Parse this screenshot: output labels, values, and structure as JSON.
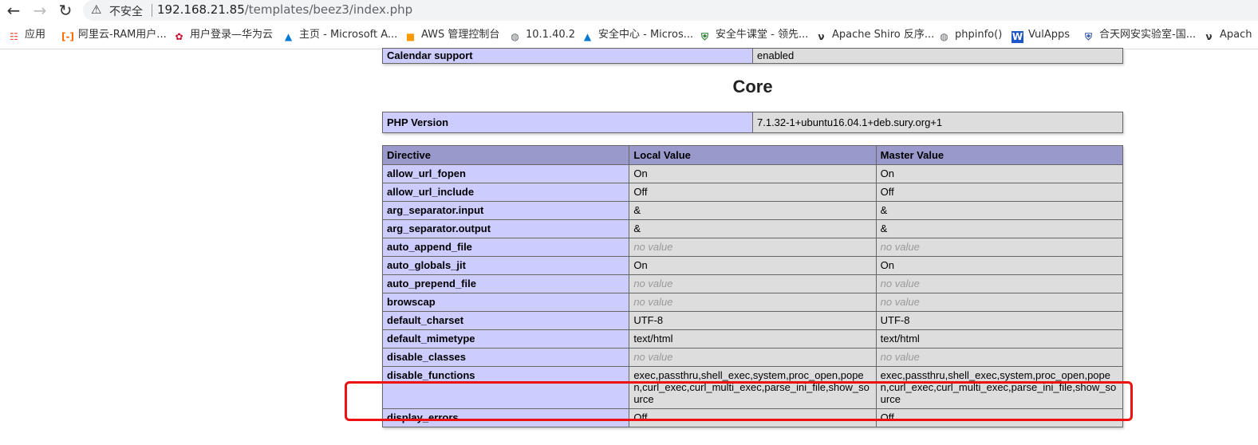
{
  "browser": {
    "insecure_label": "不安全",
    "url_host": "192.168.21.85",
    "url_path": "/templates/beez3/index.php"
  },
  "bookmarks": [
    {
      "label": "应用",
      "icon": "apps-grid-icon",
      "color": "#e8453c"
    },
    {
      "label": "阿里云-RAM用户...",
      "icon": "aliyun-icon",
      "color": "#ff6a00"
    },
    {
      "label": "用户登录—华为云",
      "icon": "huawei-icon",
      "color": "#cf0a2c"
    },
    {
      "label": "主页 - Microsoft A...",
      "icon": "azure-icon",
      "color": "#0078d4"
    },
    {
      "label": "AWS 管理控制台",
      "icon": "aws-icon",
      "color": "#ff9900"
    },
    {
      "label": "10.1.40.2",
      "icon": "globe-icon",
      "color": "#5f6368"
    },
    {
      "label": "安全中心 - Micros...",
      "icon": "azure-icon",
      "color": "#0078d4"
    },
    {
      "label": "安全牛课堂 - 领先...",
      "icon": "shield-icon",
      "color": "#2e7d32"
    },
    {
      "label": "Apache Shiro 反序...",
      "icon": "apache-feather-icon",
      "color": "#333333"
    },
    {
      "label": "phpinfo()",
      "icon": "globe-icon",
      "color": "#5f6368"
    },
    {
      "label": "VulApps",
      "icon": "word-w-icon",
      "color": "#1e56c8"
    },
    {
      "label": "合天网安实验室-国...",
      "icon": "shield-icon",
      "color": "#3b5ba5"
    },
    {
      "label": "Apach",
      "icon": "apache-feather-icon",
      "color": "#333333"
    }
  ],
  "calendar_row": {
    "name": "Calendar support",
    "value": "enabled"
  },
  "core_title": "Core",
  "php_version": {
    "name": "PHP Version",
    "value": "7.1.32-1+ubuntu16.04.1+deb.sury.org+1"
  },
  "headers": {
    "directive": "Directive",
    "local": "Local Value",
    "master": "Master Value"
  },
  "no_value": "no value",
  "directives": [
    {
      "name": "allow_url_fopen",
      "local": "On",
      "master": "On"
    },
    {
      "name": "allow_url_include",
      "local": "Off",
      "master": "Off"
    },
    {
      "name": "arg_separator.input",
      "local": "&",
      "master": "&"
    },
    {
      "name": "arg_separator.output",
      "local": "&",
      "master": "&"
    },
    {
      "name": "auto_append_file",
      "local": "no value",
      "master": "no value"
    },
    {
      "name": "auto_globals_jit",
      "local": "On",
      "master": "On"
    },
    {
      "name": "auto_prepend_file",
      "local": "no value",
      "master": "no value"
    },
    {
      "name": "browscap",
      "local": "no value",
      "master": "no value"
    },
    {
      "name": "default_charset",
      "local": "UTF-8",
      "master": "UTF-8"
    },
    {
      "name": "default_mimetype",
      "local": "text/html",
      "master": "text/html"
    },
    {
      "name": "disable_classes",
      "local": "no value",
      "master": "no value"
    },
    {
      "name": "disable_functions",
      "local": "exec,passthru,shell_exec,system,proc_open,popen,curl_exec,curl_multi_exec,parse_ini_file,show_source",
      "master": "exec,passthru,shell_exec,system,proc_open,popen,curl_exec,curl_multi_exec,parse_ini_file,show_source"
    },
    {
      "name": "display_errors",
      "local": "Off",
      "master": "Off"
    }
  ],
  "highlight_color": "#ee1111"
}
